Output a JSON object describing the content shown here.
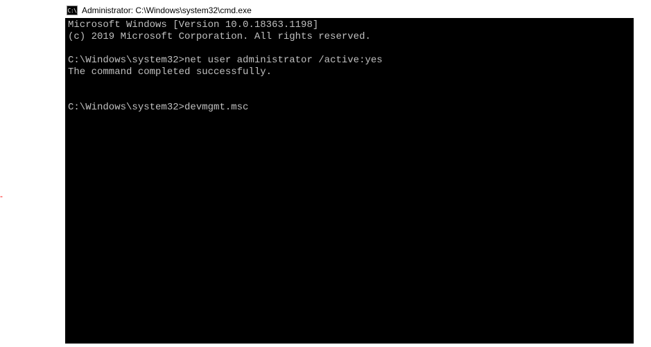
{
  "window": {
    "icon_label": "C:\\",
    "title": "Administrator: C:\\Windows\\system32\\cmd.exe"
  },
  "terminal": {
    "line1": "Microsoft Windows [Version 10.0.18363.1198]",
    "line2": "(c) 2019 Microsoft Corporation. All rights reserved.",
    "blank1": "",
    "prompt1": "C:\\Windows\\system32>",
    "cmd1": "net user administrator /active:yes",
    "result1": "The command completed successfully.",
    "blank2": "",
    "blank3": "",
    "prompt2": "C:\\Windows\\system32>",
    "cmd2": "devmgmt.msc"
  }
}
